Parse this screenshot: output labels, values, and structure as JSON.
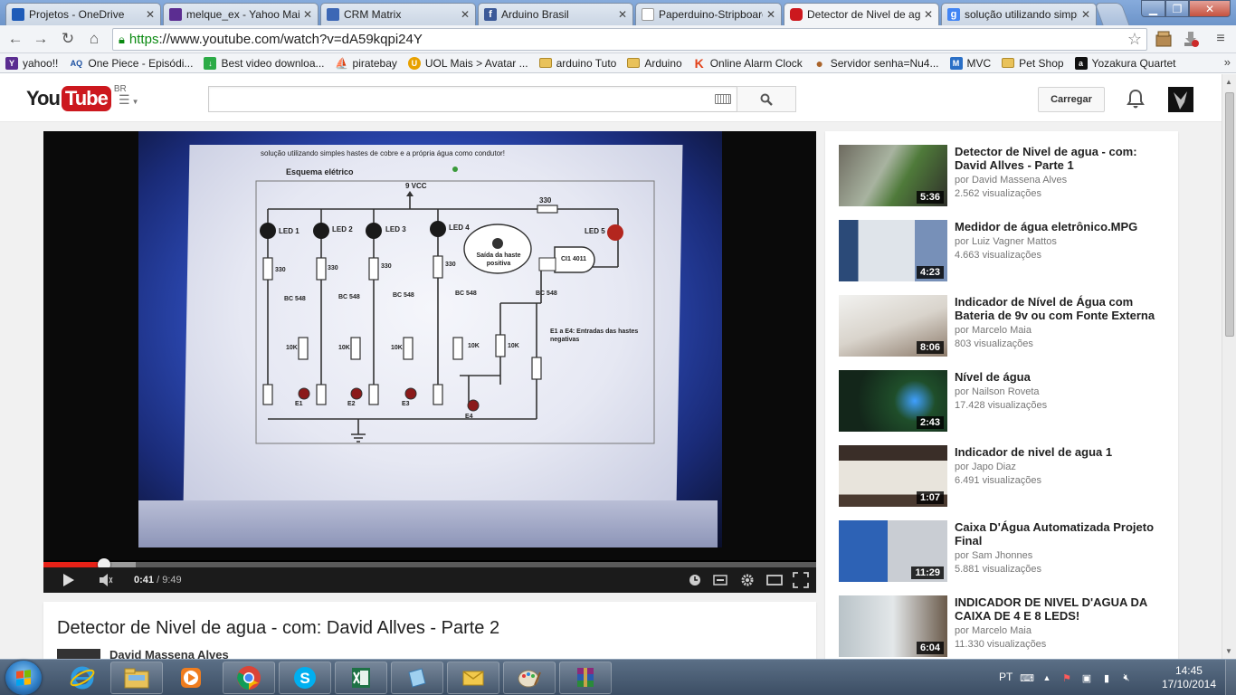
{
  "browser": {
    "tabs": [
      {
        "title": "Projetos - OneDrive",
        "favicon_color": "#1e5bb8"
      },
      {
        "title": "melque_ex - Yahoo Mail",
        "favicon_color": "#5b2d91"
      },
      {
        "title": "CRM Matrix",
        "favicon_color": "#3c67b5"
      },
      {
        "title": "Arduino Brasil",
        "favicon_color": "#3b5998"
      },
      {
        "title": "Paperduino-Stripboard",
        "favicon_color": "#ffffff"
      },
      {
        "title": "Detector de Nivel de agua",
        "favicon_color": "#cc181e"
      },
      {
        "title": "solução utilizando simples",
        "favicon_color": "#4285f4"
      }
    ],
    "active_tab_index": 5,
    "url_scheme": "https",
    "url_rest": "://www.youtube.com/watch?v=dA59kqpi24Y",
    "bookmarks": [
      {
        "label": "yahoo!!",
        "icon": "yahoo-icon",
        "color": "#5b2d91",
        "glyph": "Y"
      },
      {
        "label": "One Piece - Episódi...",
        "icon": "aq-icon",
        "color": "#1b4fa0",
        "glyph": "AQ"
      },
      {
        "label": "Best video downloa...",
        "icon": "download-icon",
        "color": "#2cab47",
        "glyph": "↓"
      },
      {
        "label": "piratebay",
        "icon": "pirate-ship-icon",
        "color": "#333333",
        "glyph": "⛵"
      },
      {
        "label": "UOL Mais > Avatar ...",
        "icon": "uol-icon",
        "color": "#e8a100",
        "glyph": "U"
      },
      {
        "label": "arduino Tuto",
        "icon": "folder-icon",
        "color": "#e9c25a",
        "glyph": ""
      },
      {
        "label": "Arduino",
        "icon": "folder-icon",
        "color": "#e9c25a",
        "glyph": ""
      },
      {
        "label": "Online Alarm Clock",
        "icon": "k-logo-icon",
        "color": "#e2421a",
        "glyph": "K"
      },
      {
        "label": "Servidor senha=Nu4...",
        "icon": "cookie-icon",
        "color": "#a9632a",
        "glyph": "●"
      },
      {
        "label": "MVC",
        "icon": "macnet-icon",
        "color": "#2a6fc6",
        "glyph": "M"
      },
      {
        "label": "Pet Shop",
        "icon": "folder-icon",
        "color": "#e9c25a",
        "glyph": ""
      },
      {
        "label": "Yozakura Quartet",
        "icon": "anime-icon",
        "color": "#111111",
        "glyph": "a"
      }
    ],
    "bookmarks_overflow": "»"
  },
  "youtube": {
    "logo_you": "You",
    "logo_tube": "Tube",
    "country": "BR",
    "search_value": "",
    "upload_label": "Carregar",
    "player": {
      "current_time": "0:41",
      "separator": " / ",
      "duration": "9:49",
      "played_fraction": 0.078,
      "buffered_fraction": 0.12
    },
    "video_title": "Detector de Nivel de agua - com: David Allves - Parte 2",
    "owner_name": "David Massena Alves",
    "related": [
      {
        "title": "Detector de Nivel de agua - com: David Allves - Parte 1",
        "by": "por David Massena Alves",
        "views": "2.562 visualizações",
        "duration": "5:36"
      },
      {
        "title": "Medidor de água eletrônico.MPG",
        "by": "por Luiz Vagner Mattos",
        "views": "4.663 visualizações",
        "duration": "4:23"
      },
      {
        "title": "Indicador de Nível de Água com Bateria de 9v ou com Fonte Externa",
        "by": "por Marcelo Maia",
        "views": "803 visualizações",
        "duration": "8:06"
      },
      {
        "title": "Nível de água",
        "by": "por Nailson Roveta",
        "views": "17.428 visualizações",
        "duration": "2:43"
      },
      {
        "title": "Indicador de nivel de agua 1",
        "by": "por Japo Diaz",
        "views": "6.491 visualizações",
        "duration": "1:07"
      },
      {
        "title": "Caixa D'Água Automatizada Projeto Final",
        "by": "por Sam Jhonnes",
        "views": "5.881 visualizações",
        "duration": "11:29"
      },
      {
        "title": "INDICADOR DE NIVEL D'AGUA DA CAIXA DE 4 E 8 LEDS!",
        "by": "por Marcelo Maia",
        "views": "11.330 visualizações",
        "duration": "6:04"
      }
    ]
  },
  "schematic": {
    "heading": "solução utilizando simples hastes de cobre e a própria água como condutor!",
    "title": "Esquema elétrico",
    "supply": "9 VCC",
    "top_resistor": "330",
    "leds": [
      "LED 1",
      "LED 2",
      "LED 3",
      "LED 4",
      "LED 5"
    ],
    "resistor_330": "330",
    "transistor": "BC 548",
    "resistor_10k": "10K",
    "probes": [
      "E1",
      "E2",
      "E3",
      "E4"
    ],
    "probe_label": "Saída da haste positiva",
    "ic": "CI1 4011",
    "note": "E1 a E4: Entradas das hastes negativas"
  },
  "taskbar": {
    "apps": [
      "internet-explorer-icon",
      "file-explorer-icon",
      "media-player-icon",
      "chrome-icon",
      "skype-icon",
      "excel-icon",
      "notes-icon",
      "outlook-icon",
      "paint-icon",
      "winrar-icon"
    ],
    "language": "PT",
    "time": "14:45",
    "date": "17/10/2014"
  },
  "colors": {
    "youtube_red": "#cc181e",
    "progress_red": "#e62117",
    "url_green": "#0b8a12",
    "taskbar": "#4a5d74"
  }
}
